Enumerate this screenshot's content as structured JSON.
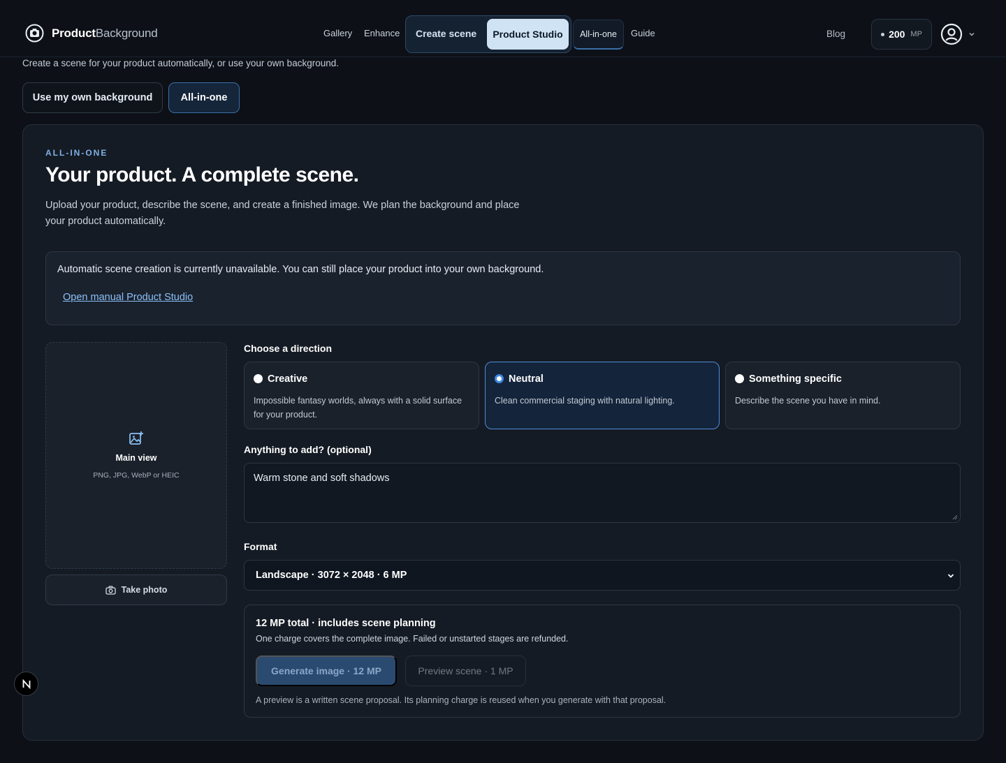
{
  "brand": {
    "name_bold": "Product",
    "name_light": "Background",
    "logo_icon": "camera-badge-icon"
  },
  "nav": {
    "gallery": "Gallery",
    "enhance": "Enhance",
    "create_scene": "Create scene",
    "product_studio": "Product Studio",
    "all_in_one": "All-in-one",
    "guide": "Guide",
    "blog": "Blog"
  },
  "credits": {
    "amount": "200",
    "unit": "MP"
  },
  "account": {
    "avatar_icon": "user-circle-icon",
    "menu_icon": "chevron-down-icon"
  },
  "page": {
    "subtitle": "Create a scene for your product automatically, or use your own background.",
    "modes": {
      "own_background": "Use my own background",
      "all_in_one": "All-in-one",
      "selected": "All-in-one"
    }
  },
  "hero": {
    "eyebrow": "ALL-IN-ONE",
    "title": "Your product. A complete scene.",
    "description": "Upload your product, describe the scene, and create a finished image. We plan the background and place your product automatically."
  },
  "notice": {
    "text": "Automatic scene creation is currently unavailable. You can still place your product into your own background.",
    "link": "Open manual Product Studio"
  },
  "upload": {
    "icon": "image-add-icon",
    "title": "Main view",
    "hint": "PNG, JPG, WebP or HEIC",
    "take_photo": "Take photo",
    "camera_icon": "camera-icon"
  },
  "direction": {
    "label": "Choose a direction",
    "selected": "Neutral",
    "options": [
      {
        "title": "Creative",
        "description": "Impossible fantasy worlds, always with a solid surface for your product."
      },
      {
        "title": "Neutral",
        "description": "Clean commercial staging with natural lighting."
      },
      {
        "title": "Something specific",
        "description": "Describe the scene you have in mind."
      }
    ]
  },
  "extras": {
    "label": "Anything to add? (optional)",
    "value": "Warm stone and soft shadows"
  },
  "format": {
    "label": "Format",
    "selected": "Landscape · 3072 × 2048 · 6 MP"
  },
  "summary": {
    "title": "12 MP total · includes scene planning",
    "subtitle": "One charge covers the complete image. Failed or unstarted stages are refunded.",
    "generate": "Generate image · 12 MP",
    "preview": "Preview scene · 1 MP",
    "note": "A preview is a written scene proposal. Its planning charge is reused when you generate with that proposal."
  },
  "floating": {
    "icon": "n-logo-icon"
  },
  "colors": {
    "accent": "#7fb0e6",
    "selected_border": "#4f8dd6",
    "background": "#0d1117",
    "card": "#151b24"
  }
}
